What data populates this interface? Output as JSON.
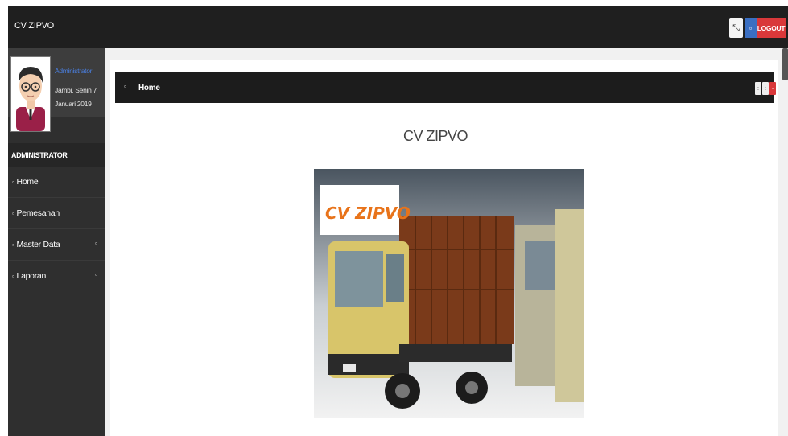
{
  "app": {
    "brand": "CV ZIPVO"
  },
  "topbar": {
    "expand_glyph": "⤡",
    "blue_glyph": "▫",
    "logout_label": "LOGOUT"
  },
  "profile": {
    "name": "Administrator",
    "date": "Jambi, Senin 7 Januari 2019"
  },
  "sidebar": {
    "heading": "ADMINISTRATOR",
    "items": [
      {
        "label": "Home",
        "has_submenu": false
      },
      {
        "label": "Pemesanan",
        "has_submenu": false
      },
      {
        "label": "Master Data",
        "has_submenu": true
      },
      {
        "label": "Laporan",
        "has_submenu": true
      }
    ],
    "bullet_glyph": "▫",
    "caret_glyph": "▫"
  },
  "panel": {
    "title": "Home",
    "icon_glyph": "▫",
    "buttons": [
      ":",
      ":",
      "▫"
    ]
  },
  "main": {
    "site_title": "CV ZIPVO",
    "hero_logo_text": "CV ZIPVO"
  },
  "colors": {
    "topbar": "#1f1f1f",
    "sidebar": "#2f2f2f",
    "logout": "#d9383a",
    "accent_blue": "#3b6fc2",
    "logo_orange": "#e8731a",
    "truck_yellow": "#d8c56a",
    "truck_cargo": "#7a3a1a"
  }
}
